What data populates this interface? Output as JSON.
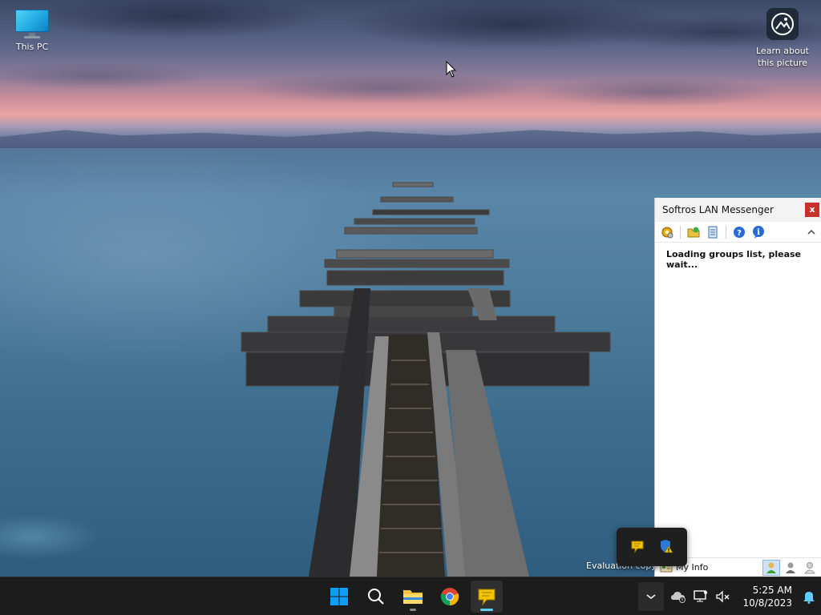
{
  "desktop": {
    "this_pc_label": "This PC",
    "learn_label": "Learn about\nthis picture"
  },
  "messenger": {
    "title": "Softros LAN Messenger",
    "close_label": "x",
    "loading_text": "Loading groups list, please wait...",
    "my_info_label": "My Info",
    "toolbar_icons": [
      "settings-gear-icon",
      "open-folder-icon",
      "message-history-icon",
      "help-icon",
      "about-info-icon"
    ]
  },
  "evaluation_text": "Evaluation copy",
  "tray_flyout": {
    "icons": [
      "softros-messenger-tray-icon",
      "security-warning-icon"
    ]
  },
  "taskbar": {
    "apps": [
      "start-button",
      "search-button",
      "file-explorer",
      "chrome",
      "softros-messenger"
    ],
    "clock_time": "5:25 AM",
    "clock_date": "10/8/2023"
  },
  "colors": {
    "taskbar_bg": "#1c1c1c",
    "accent": "#60cdff",
    "close_red": "#c9302c",
    "windows_blue": "#0f9ef5"
  }
}
